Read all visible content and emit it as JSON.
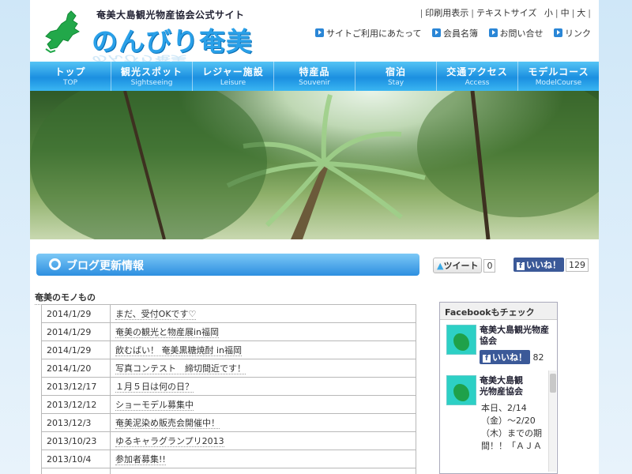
{
  "header": {
    "subtitle": "奄美大島観光物産協会公式サイト",
    "logo_text": "のんびり奄美",
    "util": {
      "print": "印刷用表示",
      "text_size": "テキストサイズ",
      "small": "小",
      "medium": "中",
      "large": "大"
    },
    "links": [
      "サイトご利用にあたって",
      "会員名簿",
      "お問い合せ",
      "リンク"
    ]
  },
  "nav": [
    {
      "jp": "トップ",
      "en": "TOP"
    },
    {
      "jp": "観光スポット",
      "en": "Sightseeing"
    },
    {
      "jp": "レジャー施設",
      "en": "Leisure"
    },
    {
      "jp": "特産品",
      "en": "Souvenir"
    },
    {
      "jp": "宿泊",
      "en": "Stay"
    },
    {
      "jp": "交通アクセス",
      "en": "Access"
    },
    {
      "jp": "モデルコース",
      "en": "ModelCourse"
    }
  ],
  "blog": {
    "heading": "ブログ更新情報",
    "tweet_label": "ツイート",
    "tweet_count": "0",
    "like_label": "いいね！",
    "like_count": "129",
    "section_title": "奄美のモノもの",
    "rows": [
      {
        "date": "2014/1/29",
        "title": "まだ、受付OKです♡"
      },
      {
        "date": "2014/1/29",
        "title": "奄美の観光と物産展in福岡"
      },
      {
        "date": "2014/1/29",
        "title": "飲むばい！ 奄美黒糖焼酎 in福岡"
      },
      {
        "date": "2014/1/20",
        "title": "写真コンテスト　締切間近です！"
      },
      {
        "date": "2013/12/17",
        "title": "１月５日は何の日？"
      },
      {
        "date": "2013/12/12",
        "title": "ショーモデル募集中"
      },
      {
        "date": "2013/12/3",
        "title": "奄美泥染め販売会開催中！"
      },
      {
        "date": "2013/10/23",
        "title": "ゆるキャラグランプリ2013"
      },
      {
        "date": "2013/10/4",
        "title": "参加者募集!!"
      },
      {
        "date": "",
        "title": ""
      }
    ]
  },
  "facebook": {
    "title": "Facebookもチェック",
    "page_name": "奄美大島観光物産協会",
    "like_label": "いいね！",
    "like_count": "82",
    "post_name": "奄美大島観光物産協会",
    "post_text": "本日、2/14（金）～2/20（木）までの期間！！「ＡＪＡ"
  },
  "colors": {
    "accent": "#2aa0e8",
    "nav": "#1b8fe0",
    "facebook": "#3b5998"
  }
}
